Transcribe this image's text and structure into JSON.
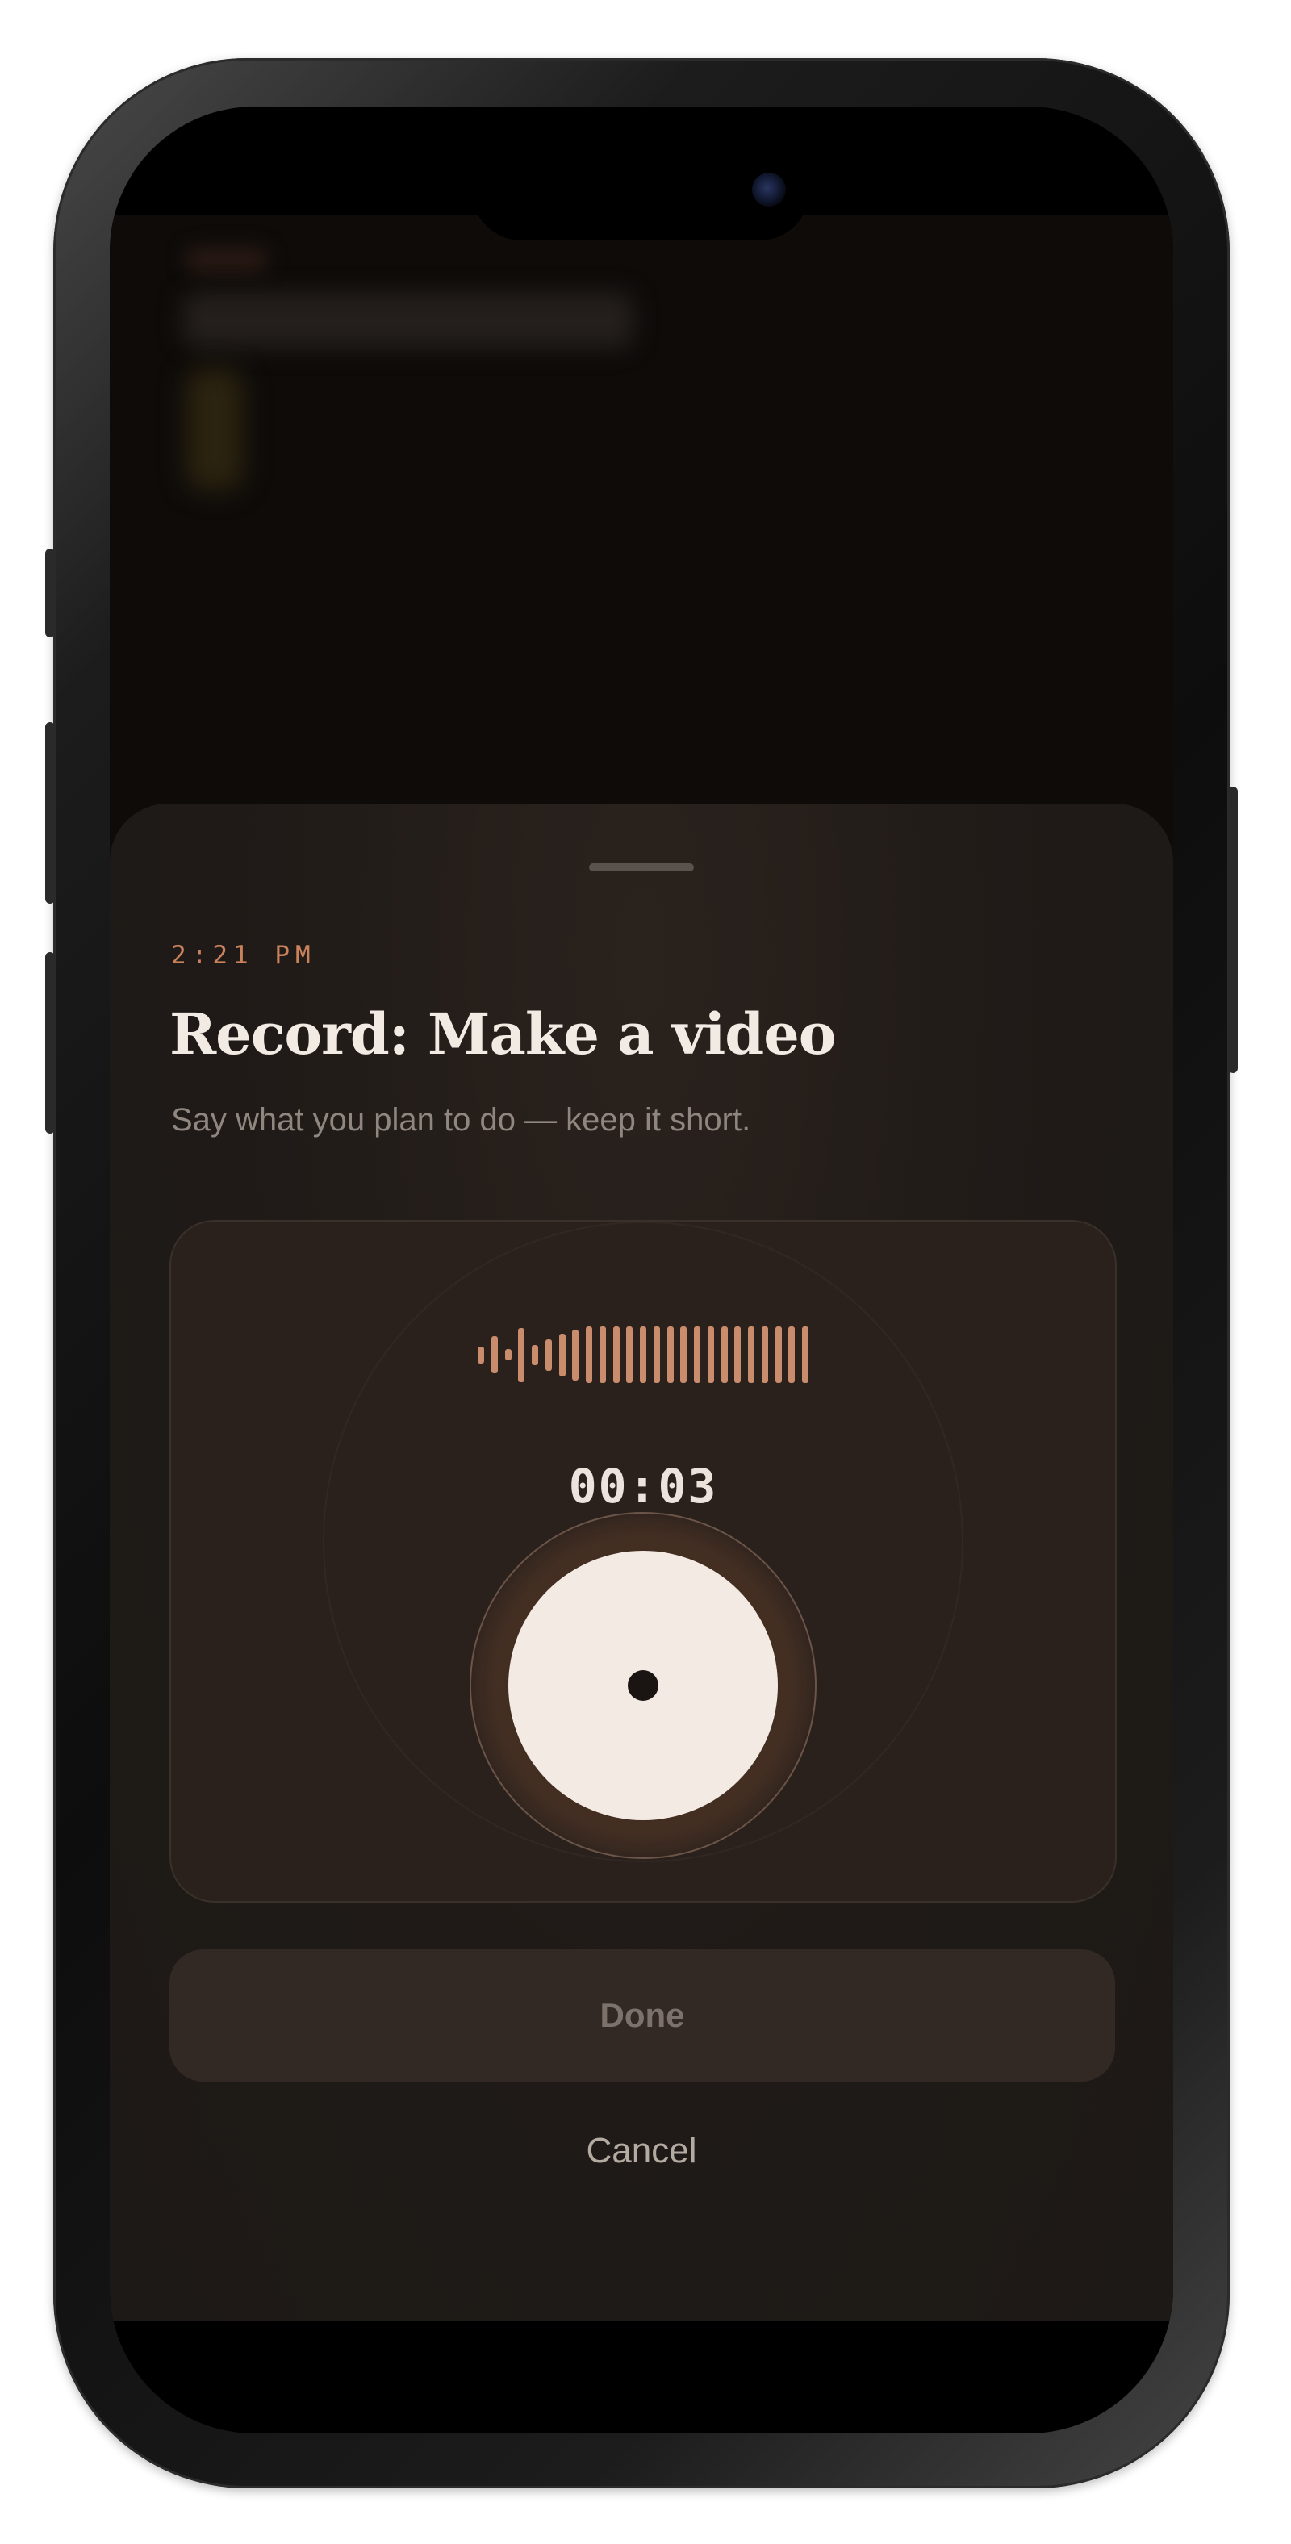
{
  "sheet": {
    "time": "2:21 PM",
    "title": "Record: Make a video",
    "subtitle": "Say what you plan to do — keep it short.",
    "timer": "00:03",
    "waveform_levels": [
      0.3,
      0.65,
      0.2,
      0.95,
      0.35,
      0.55,
      0.75,
      0.9,
      1,
      1,
      1,
      1,
      1,
      1,
      1,
      1,
      1,
      1,
      1,
      1,
      1,
      1,
      1,
      1,
      1
    ],
    "done_label": "Done",
    "cancel_label": "Cancel"
  },
  "colors": {
    "accent": "#c9825c",
    "sheet_background": "#1f1a17",
    "record_button": "#f3ebe3"
  }
}
